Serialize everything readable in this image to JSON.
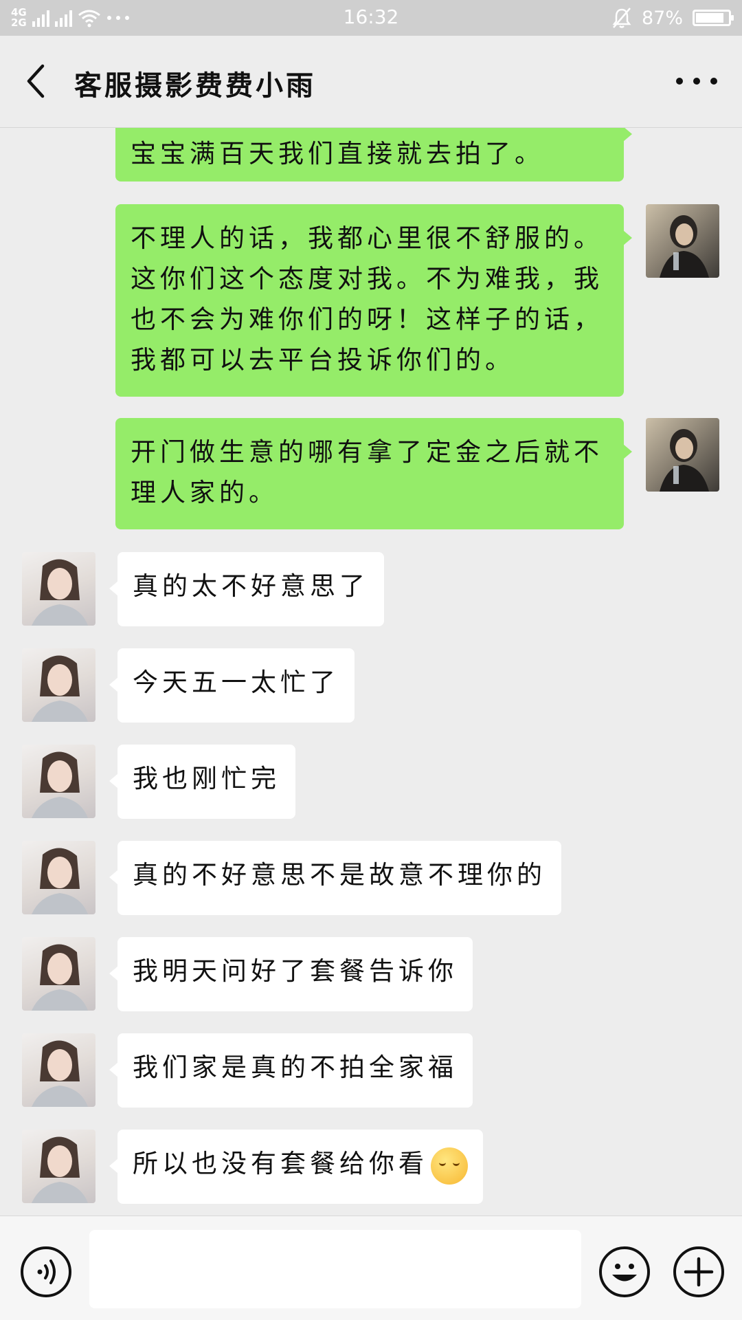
{
  "status_bar": {
    "network_top": "4G",
    "network_bottom": "2G",
    "time": "16:32",
    "battery_text": "87%",
    "battery_level": 0.87,
    "icons": [
      "signal-icon",
      "wifi-icon",
      "more-dots-icon",
      "silent-bell-icon",
      "battery-icon"
    ]
  },
  "header": {
    "title": "客服摄影费费小雨",
    "back_icon": "chevron-left-icon",
    "more_icon": "more-horizontal-icon"
  },
  "messages": [
    {
      "side": "out",
      "text": "宝宝满百天我们直接就去拍了。"
    },
    {
      "side": "out",
      "text": "不理人的话，我都心里很不舒服的。这你们这个态度对我。不为难我，我也不会为难你们的呀！这样子的话，我都可以去平台投诉你们的。"
    },
    {
      "side": "out",
      "text": "开门做生意的哪有拿了定金之后就不理人家的。"
    },
    {
      "side": "in",
      "text": "真的太不好意思了"
    },
    {
      "side": "in",
      "text": "今天五一太忙了"
    },
    {
      "side": "in",
      "text": "我也刚忙完"
    },
    {
      "side": "in",
      "text": "真的不好意思不是故意不理你的"
    },
    {
      "side": "in",
      "text": "我明天问好了套餐告诉你"
    },
    {
      "side": "in",
      "text": "我们家是真的不拍全家福"
    },
    {
      "side": "in",
      "text": "所以也没有套餐给你看",
      "emoji": "smiling-face-emoji"
    }
  ],
  "input_bar": {
    "voice_icon": "voice-icon",
    "emoji_icon": "emoji-icon",
    "plus_icon": "plus-icon",
    "input_value": ""
  }
}
